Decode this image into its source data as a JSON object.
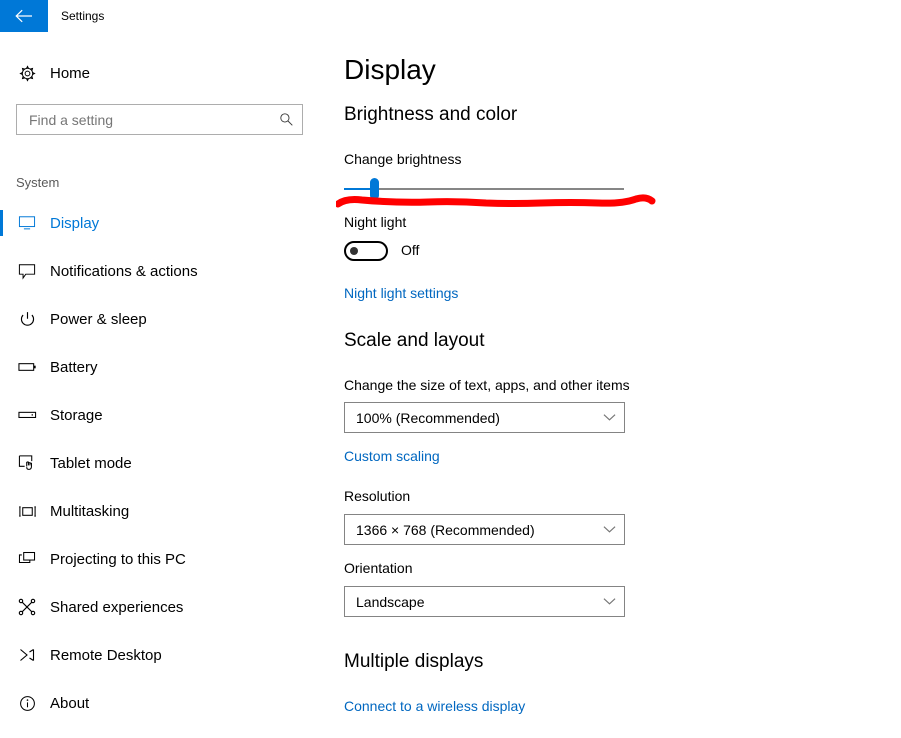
{
  "window": {
    "title": "Settings",
    "back_icon": "back-arrow-icon",
    "accent_color": "#0078d7"
  },
  "sidebar": {
    "home": {
      "label": "Home",
      "icon": "gear-icon"
    },
    "search": {
      "value": "",
      "placeholder": "Find a setting",
      "icon": "search-icon"
    },
    "group_label": "System",
    "items": [
      {
        "label": "Display",
        "icon": "monitor-icon",
        "selected": true
      },
      {
        "label": "Notifications & actions",
        "icon": "speech-bubble-icon",
        "selected": false
      },
      {
        "label": "Power & sleep",
        "icon": "power-icon",
        "selected": false
      },
      {
        "label": "Battery",
        "icon": "battery-icon",
        "selected": false
      },
      {
        "label": "Storage",
        "icon": "drive-icon",
        "selected": false
      },
      {
        "label": "Tablet mode",
        "icon": "tablet-touch-icon",
        "selected": false
      },
      {
        "label": "Multitasking",
        "icon": "multitask-window-icon",
        "selected": false
      },
      {
        "label": "Projecting to this PC",
        "icon": "project-screen-icon",
        "selected": false
      },
      {
        "label": "Shared experiences",
        "icon": "share-nodes-icon",
        "selected": false
      },
      {
        "label": "Remote Desktop",
        "icon": "remote-desktop-icon",
        "selected": false
      },
      {
        "label": "About",
        "icon": "info-circle-icon",
        "selected": false
      }
    ]
  },
  "main": {
    "page_title": "Display",
    "brightness_section": {
      "heading": "Brightness and color",
      "slider_label": "Change brightness",
      "slider_value_percent": 11,
      "night_light_label": "Night light",
      "night_light_state": "Off",
      "night_light_link": "Night light settings"
    },
    "scale_section": {
      "heading": "Scale and layout",
      "scale_label": "Change the size of text, apps, and other items",
      "scale_value": "100% (Recommended)",
      "custom_scaling_link": "Custom scaling",
      "resolution_label": "Resolution",
      "resolution_value": "1366 × 768 (Recommended)",
      "orientation_label": "Orientation",
      "orientation_value": "Landscape"
    },
    "multiple_displays_section": {
      "heading": "Multiple displays",
      "wireless_link": "Connect to a wireless display"
    }
  },
  "annotation": {
    "type": "red-underline-stroke",
    "color": "#ff0000"
  }
}
